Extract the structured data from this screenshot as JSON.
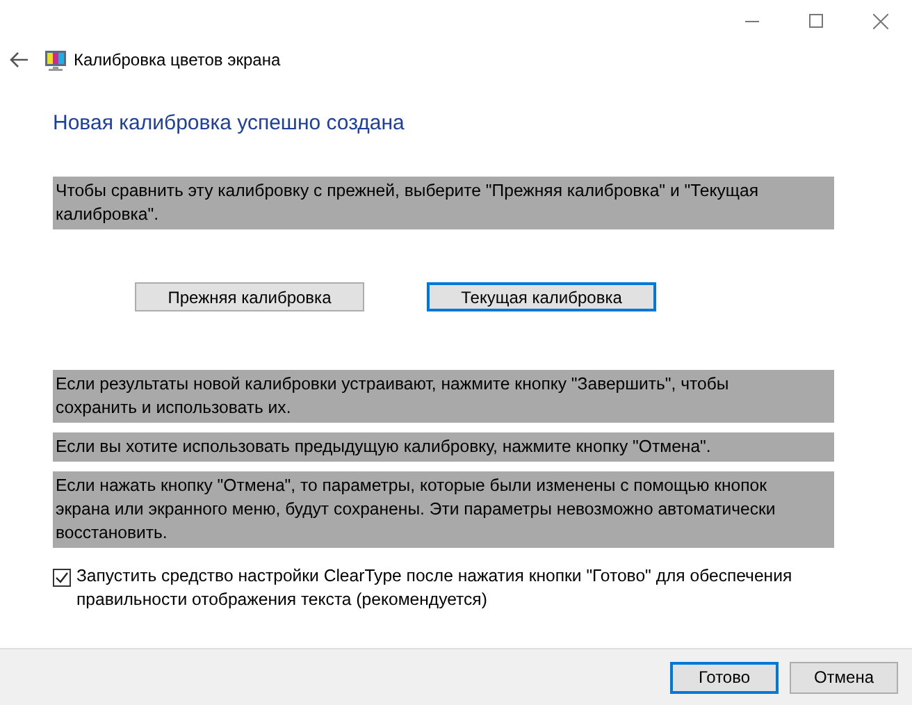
{
  "window": {
    "title": "Калибровка цветов экрана"
  },
  "heading": "Новая калибровка успешно создана",
  "paragraphs": [
    "Чтобы сравнить эту калибровку с прежней, выберите \"Прежняя калибровка\" и \"Текущая калибровка\"."
  ],
  "compare_buttons": [
    {
      "label": "Прежняя калибровка",
      "selected": false
    },
    {
      "label": "Текущая калибровка",
      "selected": true
    }
  ],
  "notes": [
    "Если результаты новой калибровки устраивают, нажмите кнопку \"Завершить\", чтобы сохранить и использовать их.",
    "Если вы хотите использовать предыдущую калибровку, нажмите кнопку \"Отмена\".",
    "Если нажать кнопку \"Отмена\", то параметры, которые были изменены с помощью кнопок экрана или экранного меню, будут сохранены. Эти параметры невозможно автоматически восстановить."
  ],
  "cleartype": {
    "label": "Запустить средство настройки ClearType после нажатия кнопки \"Готово\" для обеспечения правильности отображения текста (рекомендуется)",
    "checked": true
  },
  "footer_buttons": [
    {
      "label": "Готово",
      "selected": true
    },
    {
      "label": "Отмена",
      "selected": false
    }
  ]
}
